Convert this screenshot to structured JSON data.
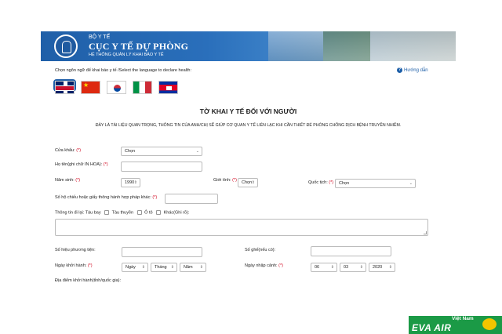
{
  "header": {
    "org": "BỘ Y TẾ",
    "title": "CỤC Y TẾ DỰ PHÒNG",
    "subtitle": "HỆ THỐNG QUẢN LÝ KHAI BÁO Y TẾ"
  },
  "language": {
    "label": "Chọn ngôn ngữ để khai báo y tế /Select the language to declare health:",
    "flags": [
      "vietnam-flag-icon",
      "uk-flag-icon",
      "china-flag-icon",
      "korea-flag-icon",
      "italy-flag-icon",
      "cambodia-flag-icon"
    ]
  },
  "help": {
    "icon": "question-icon",
    "label": "Hướng dẫn"
  },
  "form": {
    "title": "TỜ KHAI Y TẾ ĐỐI VỚI NGƯỜI",
    "notice": "ĐÂY LÀ TÀI LIỆU QUAN TRỌNG, THÔNG TIN CỦA ANH/CHỊ SẼ GIÚP CƠ QUAN Y TẾ LIÊN LẠC KHI CẦN THIẾT ĐỂ PHÒNG CHỐNG DỊCH BỆNH TRUYỀN NHIỄM.",
    "required_mark": "(*)",
    "gate": {
      "label": "Cửa khẩu:",
      "value": "Chọn"
    },
    "fullname": {
      "label": "Họ tên(ghi chữ IN HOA):",
      "value": ""
    },
    "birth_year": {
      "label": "Năm sinh:",
      "value": "1990"
    },
    "gender": {
      "label": "Giới tính:",
      "value": "Chọn"
    },
    "nationality": {
      "label": "Quốc tịch:",
      "value": "Chọn"
    },
    "passport": {
      "label": "Số hộ chiếu hoặc giấy thông hành hợp pháp khác:",
      "value": ""
    },
    "travel_info": {
      "label": "Thông tin đi lại: Tàu bay",
      "options": [
        "Tàu thuyền",
        "Ô tô",
        "Khác(Ghi rõ):"
      ]
    },
    "vehicle_no": {
      "label": "Số hiệu phương tiện:",
      "value": ""
    },
    "seat_no": {
      "label": "Số ghế(nếu có):",
      "value": ""
    },
    "depart_date": {
      "label": "Ngày khởi hành:",
      "day": "Ngày",
      "month": "Tháng",
      "year": "Năm"
    },
    "entry_date": {
      "label": "Ngày nhập cảnh:",
      "day": "06",
      "month": "03",
      "year": "2020"
    },
    "departure_place": {
      "label": "Địa điểm khởi hành(tỉnh/quốc gia):"
    }
  },
  "watermark": {
    "country": "Việt Nam",
    "brand": "EVA AIR"
  },
  "colors": {
    "banner": "#1f5fa8",
    "required": "#d0021b",
    "link": "#1d5fa8",
    "watermark": "#1b9a46"
  }
}
